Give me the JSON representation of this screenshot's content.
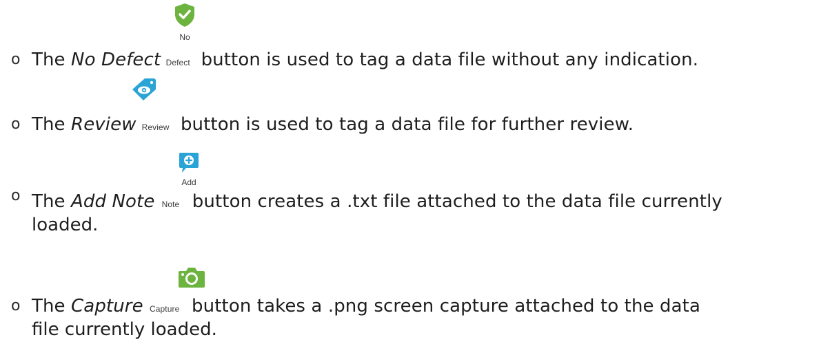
{
  "items": [
    {
      "bullet": "o",
      "pre": "The ",
      "name": "No Defect",
      "btn_line1": "No",
      "btn_line2": "Defect",
      "post": " button is used to tag a data file without any indication.",
      "icon": "shield-check-icon",
      "color": "#6db33f"
    },
    {
      "bullet": "o",
      "pre": "The ",
      "name": "Review",
      "btn_label": "Review",
      "post": " button is used to tag a data file for further review.",
      "icon": "eye-tag-icon",
      "color": "#2aa3d6"
    },
    {
      "bullet": "o",
      "pre": "The ",
      "name": "Add Note",
      "btn_line1": "Add",
      "btn_line2": "Note",
      "post": " button creates a .txt file attached to the data file currently",
      "cont": "loaded.",
      "icon": "note-add-icon",
      "color": "#2aa3d6"
    },
    {
      "bullet": "o",
      "pre": "The ",
      "name": "Capture",
      "btn_label": "Capture",
      "post": " button takes a .png screen capture attached to the data",
      "cont": "file currently loaded.",
      "icon": "camera-icon",
      "color": "#6db33f"
    }
  ]
}
